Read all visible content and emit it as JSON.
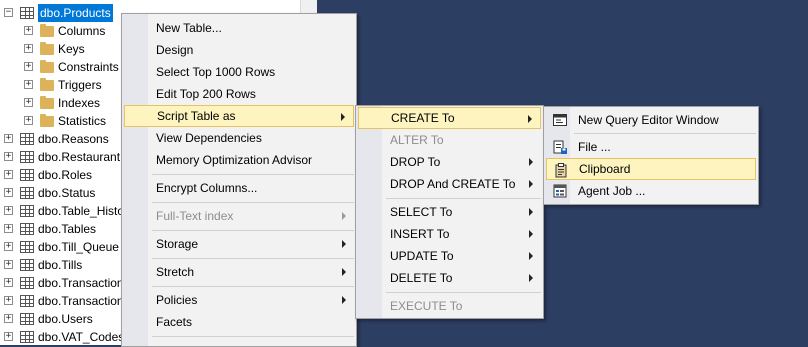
{
  "tree": {
    "selected": "dbo.Products",
    "items": [
      {
        "label": "dbo.Products",
        "level": 0,
        "kind": "table",
        "expanded": true
      },
      {
        "label": "Columns",
        "level": 1,
        "kind": "folder"
      },
      {
        "label": "Keys",
        "level": 1,
        "kind": "folder"
      },
      {
        "label": "Constraints",
        "level": 1,
        "kind": "folder"
      },
      {
        "label": "Triggers",
        "level": 1,
        "kind": "folder"
      },
      {
        "label": "Indexes",
        "level": 1,
        "kind": "folder"
      },
      {
        "label": "Statistics",
        "level": 1,
        "kind": "folder"
      },
      {
        "label": "dbo.Reasons",
        "level": 0,
        "kind": "table"
      },
      {
        "label": "dbo.Restaurant",
        "level": 0,
        "kind": "table"
      },
      {
        "label": "dbo.Roles",
        "level": 0,
        "kind": "table"
      },
      {
        "label": "dbo.Status",
        "level": 0,
        "kind": "table"
      },
      {
        "label": "dbo.Table_Histo",
        "level": 0,
        "kind": "table"
      },
      {
        "label": "dbo.Tables",
        "level": 0,
        "kind": "table"
      },
      {
        "label": "dbo.Till_Queue",
        "level": 0,
        "kind": "table"
      },
      {
        "label": "dbo.Tills",
        "level": 0,
        "kind": "table"
      },
      {
        "label": "dbo.Transaction",
        "level": 0,
        "kind": "table"
      },
      {
        "label": "dbo.Transaction",
        "level": 0,
        "kind": "table"
      },
      {
        "label": "dbo.Users",
        "level": 0,
        "kind": "table"
      },
      {
        "label": "dbo.VAT_Codes",
        "level": 0,
        "kind": "table"
      }
    ]
  },
  "context_menu": {
    "items": [
      {
        "label": "New Table...",
        "name": "menu-new-table"
      },
      {
        "label": "Design",
        "name": "menu-design"
      },
      {
        "label": "Select Top 1000 Rows",
        "name": "menu-select-top-1000"
      },
      {
        "label": "Edit Top 200 Rows",
        "name": "menu-edit-top-200"
      },
      {
        "label": "Script Table as",
        "name": "menu-script-table-as",
        "submenu": true,
        "highlighted": true
      },
      {
        "label": "View Dependencies",
        "name": "menu-view-dependencies"
      },
      {
        "label": "Memory Optimization Advisor",
        "name": "menu-memory-optimization-advisor"
      },
      {
        "separator": true
      },
      {
        "label": "Encrypt Columns...",
        "name": "menu-encrypt-columns"
      },
      {
        "separator": true
      },
      {
        "label": "Full-Text index",
        "name": "menu-full-text-index",
        "submenu": true,
        "disabled": true
      },
      {
        "separator": true
      },
      {
        "label": "Storage",
        "name": "menu-storage",
        "submenu": true
      },
      {
        "separator": true
      },
      {
        "label": "Stretch",
        "name": "menu-stretch",
        "submenu": true
      },
      {
        "separator": true
      },
      {
        "label": "Policies",
        "name": "menu-policies",
        "submenu": true
      },
      {
        "label": "Facets",
        "name": "menu-facets"
      },
      {
        "separator": true
      }
    ]
  },
  "script_menu": {
    "items": [
      {
        "label": "CREATE To",
        "name": "menu-create-to",
        "submenu": true,
        "highlighted": true
      },
      {
        "label": "ALTER To",
        "name": "menu-alter-to",
        "disabled": true
      },
      {
        "label": "DROP To",
        "name": "menu-drop-to",
        "submenu": true
      },
      {
        "label": "DROP And CREATE To",
        "name": "menu-drop-and-create-to",
        "submenu": true
      },
      {
        "separator": true
      },
      {
        "label": "SELECT To",
        "name": "menu-select-to",
        "submenu": true
      },
      {
        "label": "INSERT To",
        "name": "menu-insert-to",
        "submenu": true
      },
      {
        "label": "UPDATE To",
        "name": "menu-update-to",
        "submenu": true
      },
      {
        "label": "DELETE To",
        "name": "menu-delete-to",
        "submenu": true
      },
      {
        "separator": true
      },
      {
        "label": "EXECUTE To",
        "name": "menu-execute-to",
        "disabled": true
      }
    ]
  },
  "create_menu": {
    "items": [
      {
        "label": "New Query Editor Window",
        "name": "menu-new-query-editor-window",
        "icon": "query-window-icon"
      },
      {
        "separator": true
      },
      {
        "label": "File ...",
        "name": "menu-file",
        "icon": "file-save-icon"
      },
      {
        "label": "Clipboard",
        "name": "menu-clipboard",
        "icon": "clipboard-icon",
        "highlighted": true
      },
      {
        "label": "Agent Job ...",
        "name": "menu-agent-job",
        "icon": "agent-job-icon"
      }
    ]
  }
}
